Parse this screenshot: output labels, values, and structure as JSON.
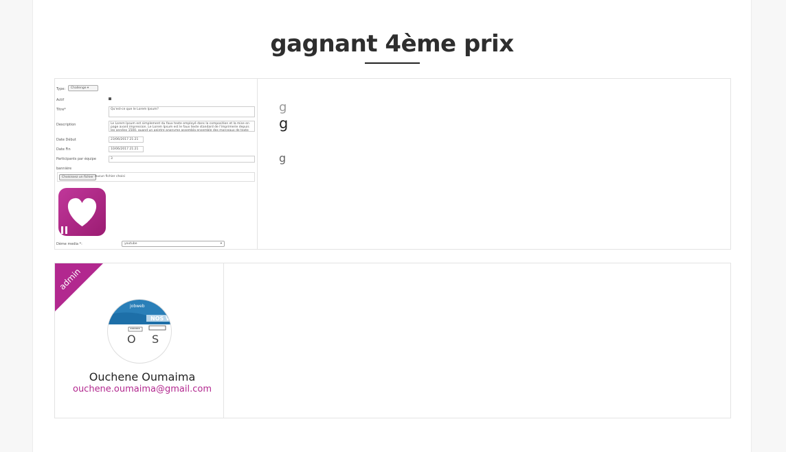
{
  "page": {
    "title": "gagnant 4ème prix"
  },
  "entry": {
    "screenshot": {
      "type_label": "Type:",
      "type_value": "Challenge",
      "actif_label": "Actif",
      "titre_label": "Titre*",
      "titre_value": "Qu'est-ce que le Lorem Ipsum?",
      "description_label": "Description",
      "description_value": "Le Lorem Ipsum est simplement du faux texte employé dans la composition et la mise en page avant impression. Le Lorem Ipsum est le faux texte standard de l'imprimerie depuis les années 1500, quand un peintre anonyme assembla ensemble des morceaux de texte",
      "date_debut_label": "Date Début",
      "date_debut_value": "23/06/2017 21:21",
      "date_fin_label": "Date Fin",
      "date_fin_value": "10/06/2017 21:21",
      "participants_label": "Participants par équipe",
      "participants_value": "3",
      "banniere_label": "bannière",
      "file_button": "Choisissez un fichier",
      "file_status": "Aucun fichier choisi",
      "media_label": "Dème media *:",
      "media_value": "youtube"
    },
    "lines": [
      "g",
      "g",
      "g"
    ]
  },
  "user": {
    "role_badge": "admin",
    "name": "Ouchene Oumaima",
    "email": "ouchene.oumaima@gmail.com",
    "avatar_text": {
      "brand": "jobweb",
      "banner": "NOS V",
      "letters": [
        "O",
        "S"
      ]
    }
  },
  "colors": {
    "accent": "#b2288f",
    "heart_logo": "#b02a8e"
  }
}
